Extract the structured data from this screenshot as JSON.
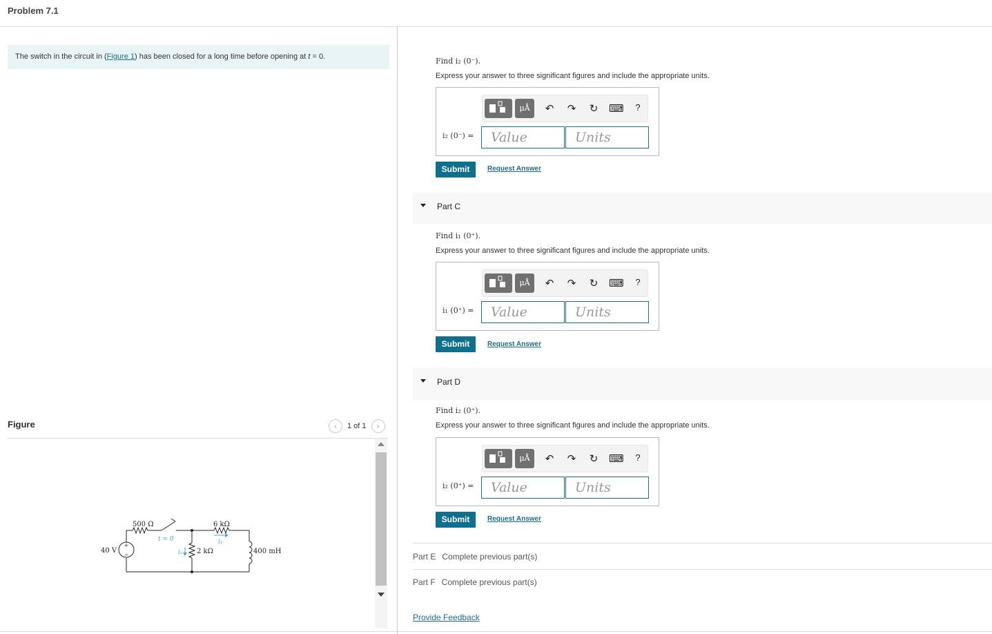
{
  "header": {
    "title": "Problem 7.1"
  },
  "problem": {
    "statement_before": "The switch in the circuit in (",
    "figure_link": "Figure 1",
    "statement_after": ") has been closed for a long time before opening at ",
    "time_var": "t",
    "statement_end": " = 0."
  },
  "figure": {
    "title": "Figure",
    "pager": "1 of 1",
    "prev_icon": "chevron-left-icon",
    "next_icon": "chevron-right-icon",
    "circuit": {
      "source": "40 V",
      "r1": "500 Ω",
      "switch": "t = 0",
      "r2": "6 kΩ",
      "r3": "2 kΩ",
      "inductor": "400 mH",
      "i1": "i₁",
      "i2": "i₂",
      "plus": "+",
      "minus": "−"
    }
  },
  "toolbar": {
    "templates_icon": "templates-icon",
    "units_label": "μÅ",
    "undo_icon": "↶",
    "redo_icon": "↷",
    "reset_icon": "↻",
    "keyboard_icon": "⌨",
    "help_label": "?"
  },
  "parts": [
    {
      "title": "",
      "find": "Find i₂ (0⁻).",
      "express": "Express your answer to three significant figures and include the appropriate units.",
      "answer_label": "i₂ (0⁻) =",
      "value_placeholder": "Value",
      "units_placeholder": "Units",
      "submit": "Submit",
      "request": "Request Answer"
    },
    {
      "title": "Part C",
      "find": "Find i₁ (0⁺).",
      "express": "Express your answer to three significant figures and include the appropriate units.",
      "answer_label": "i₁ (0⁺) =",
      "value_placeholder": "Value",
      "units_placeholder": "Units",
      "submit": "Submit",
      "request": "Request Answer"
    },
    {
      "title": "Part D",
      "find": "Find i₂ (0⁺).",
      "express": "Express your answer to three significant figures and include the appropriate units.",
      "answer_label": "i₂ (0⁺) =",
      "value_placeholder": "Value",
      "units_placeholder": "Units",
      "submit": "Submit",
      "request": "Request Answer"
    }
  ],
  "locked_parts": [
    {
      "title": "Part E",
      "status": "Complete previous part(s)"
    },
    {
      "title": "Part F",
      "status": "Complete previous part(s)"
    }
  ],
  "feedback": "Provide Feedback",
  "colors": {
    "accent": "#0f6f8e",
    "link": "#1a6e8e",
    "statement_bg": "#e8f4f5"
  }
}
